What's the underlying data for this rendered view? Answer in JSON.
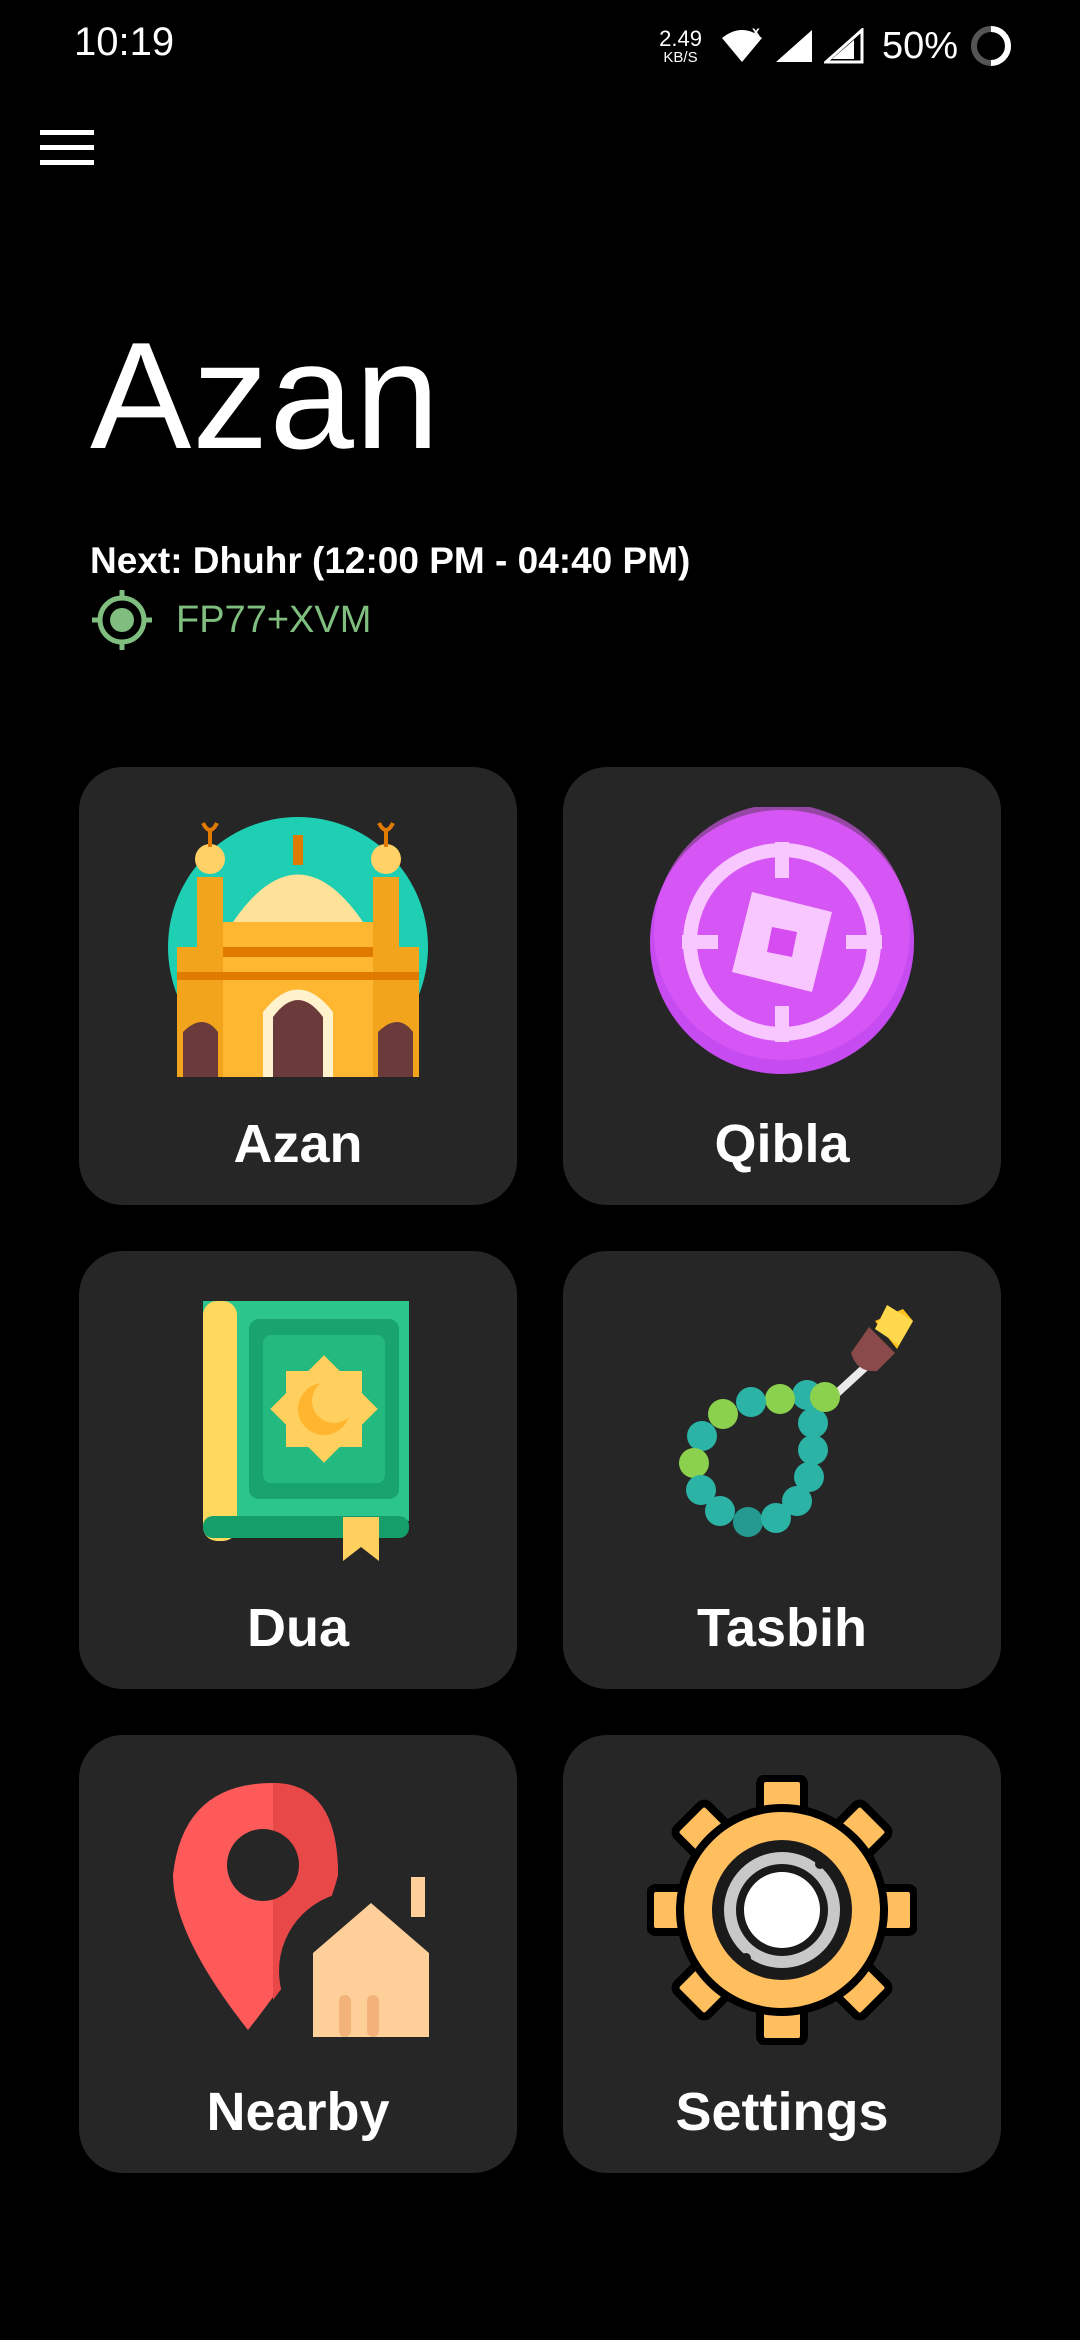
{
  "status_bar": {
    "time": "10:19",
    "net_speed_value": "2.49",
    "net_speed_unit": "KB/S",
    "battery": "50%"
  },
  "header": {
    "title": "Azan",
    "next_prayer": "Next: Dhuhr (12:00 PM - 04:40 PM)",
    "location": "FP77+XVM"
  },
  "tiles": [
    {
      "label": "Azan",
      "icon": "mosque-icon"
    },
    {
      "label": "Qibla",
      "icon": "compass-icon"
    },
    {
      "label": "Dua",
      "icon": "quran-book-icon"
    },
    {
      "label": "Tasbih",
      "icon": "prayer-beads-icon"
    },
    {
      "label": "Nearby",
      "icon": "location-pin-home-icon"
    },
    {
      "label": "Settings",
      "icon": "gear-icon"
    }
  ],
  "colors": {
    "background": "#000000",
    "tile": "#262626",
    "location_accent": "#7fbe7f"
  }
}
